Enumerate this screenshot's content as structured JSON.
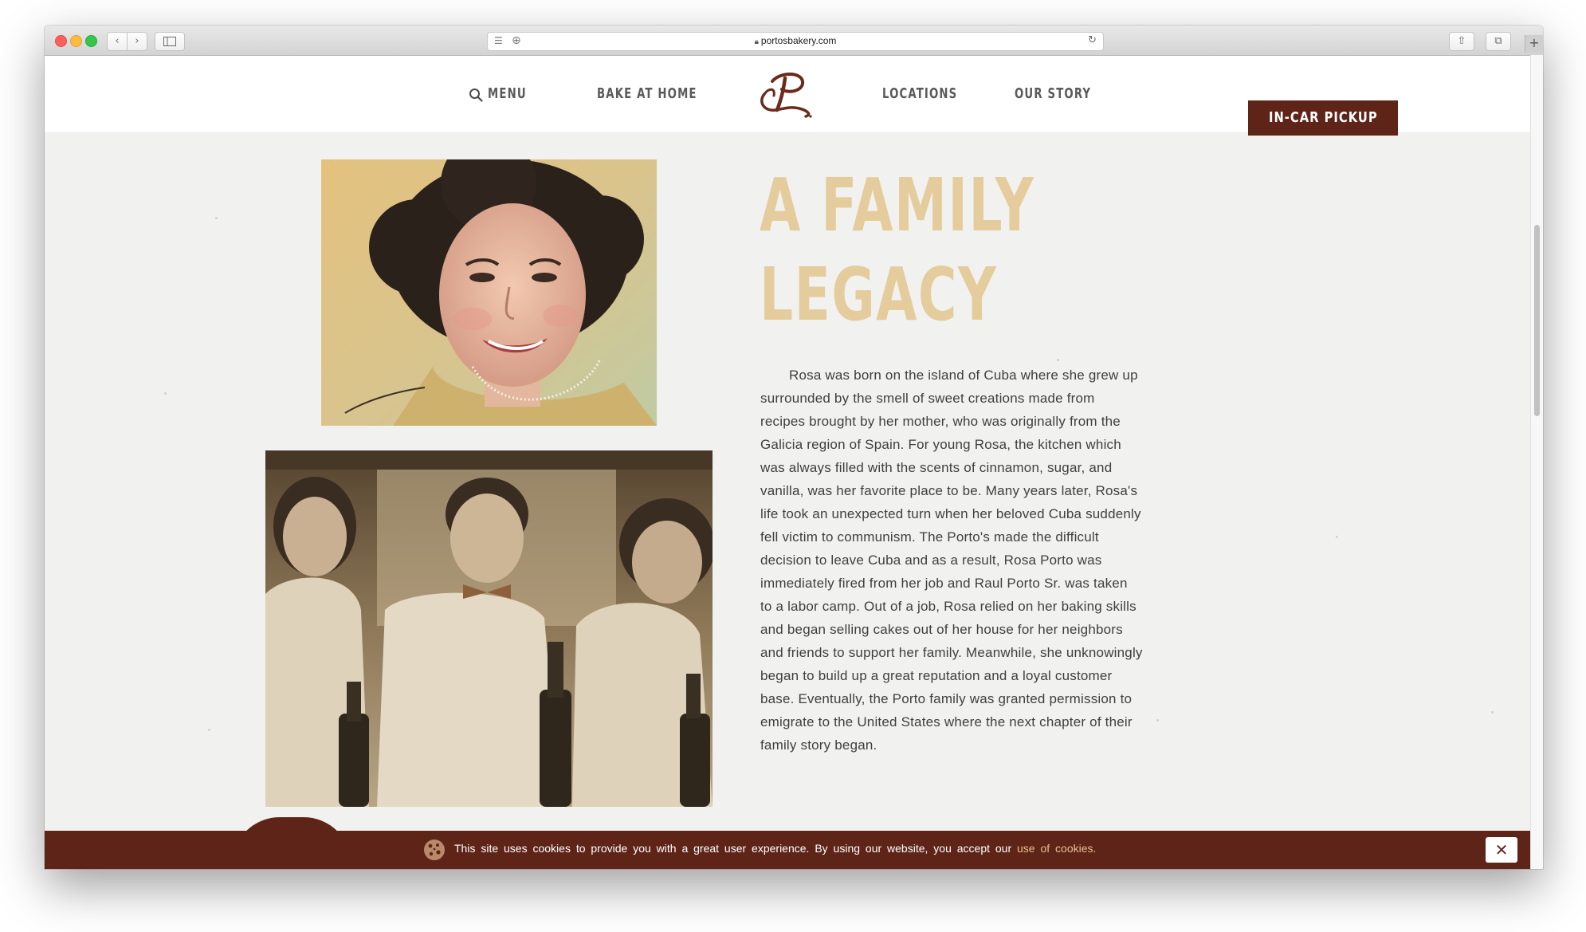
{
  "browser": {
    "url": "portosbakery.com"
  },
  "nav": {
    "menu": "MENU",
    "bake_at_home": "BAKE AT HOME",
    "locations": "LOCATIONS",
    "our_story": "OUR STORY",
    "pickup_button": "IN-CAR PICKUP"
  },
  "content": {
    "headline_line1": "A FAMILY",
    "headline_line2": "LEGACY",
    "story": "Rosa was born on the island of Cuba where she grew up surrounded by the smell of sweet creations made from recipes brought by her mother, who was originally from the Galicia region of Spain. For young Rosa, the kitchen which was always filled with the scents of cinnamon, sugar, and vanilla, was her favorite place to be. Many years later, Rosa's life took an unexpected turn when her beloved Cuba suddenly fell victim to communism. The Porto's made the difficult decision to leave Cuba and as a result, Rosa Porto was immediately fired from her job and Raul Porto Sr. was taken to a labor camp. Out of a job, Rosa relied on her baking skills and began selling cakes out of her house for her neighbors and friends to support her family. Meanwhile, she unknowingly began to build up a great reputation and a loyal customer base. Eventually, the Porto family was granted permission to emigrate to the United States where the next chapter of their family story began."
  },
  "cookie_bar": {
    "text": "This site uses cookies to provide you with a great user experience. By using our website, you accept our",
    "link": "use of cookies.",
    "close": "✕"
  },
  "colors": {
    "brand": "#5e2418",
    "headline": "#e5cc9c",
    "page_bg": "#f1f1ef"
  }
}
